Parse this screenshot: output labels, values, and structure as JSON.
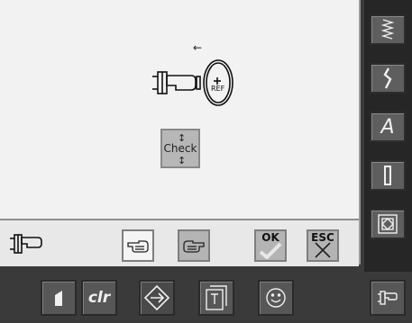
{
  "center": {
    "ref_label": "REF",
    "check_label": "Check",
    "direction_arrow": "←"
  },
  "actions": {
    "ok_label": "OK",
    "esc_label": "ESC"
  },
  "bottom_bar": {
    "clr_label": "clr"
  },
  "sidebar": {
    "alphabet_label": "A"
  }
}
